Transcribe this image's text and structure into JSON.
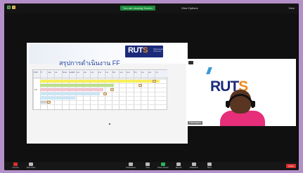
{
  "topbar": {
    "sharing_banner": "You are viewing Screen",
    "view_label": "View Options",
    "view_button": "View"
  },
  "slide": {
    "logo_main": "RUT",
    "logo_accent": "S",
    "logo_sub": "Rajamangala University",
    "title": "สรุปการดำเนินงาน FF",
    "table_headers": [
      "ลำดับ",
      "ปี",
      "แผน",
      "ผล",
      "ร้อยละ",
      "ผลลัพธ์",
      "ต.ค.",
      "พ.ย.",
      "ธ.ค.",
      "ม.ค.",
      "ก.พ.",
      "มี.ค.",
      "เม.ย.",
      "พ.ค.",
      "มิ.ย.",
      "ก.ค.",
      "ส.ค.",
      "ก.ย."
    ],
    "row_label": "FF",
    "colors": {
      "yellow": "#f7ef5a",
      "green": "#b9e08a",
      "pink": "#f3c4d3",
      "blue": "#c9e6f7",
      "grey": "#d0d0d0"
    }
  },
  "camera": {
    "logo_main": "RUT",
    "logo_accent": "S",
    "participant_name": "Participant"
  },
  "controls": [
    {
      "label": "Unmute",
      "icon": "microphone-icon"
    },
    {
      "label": "Start Video",
      "icon": "video-camera-icon"
    },
    {
      "label": "Participants",
      "icon": "participants-icon"
    },
    {
      "label": "Chat",
      "icon": "chat-icon"
    },
    {
      "label": "Share Screen",
      "icon": "share-screen-icon"
    },
    {
      "label": "Record",
      "icon": "record-icon"
    },
    {
      "label": "Reactions",
      "icon": "reactions-icon"
    },
    {
      "label": "More",
      "icon": "more-icon"
    }
  ],
  "leave_label": "Leave"
}
